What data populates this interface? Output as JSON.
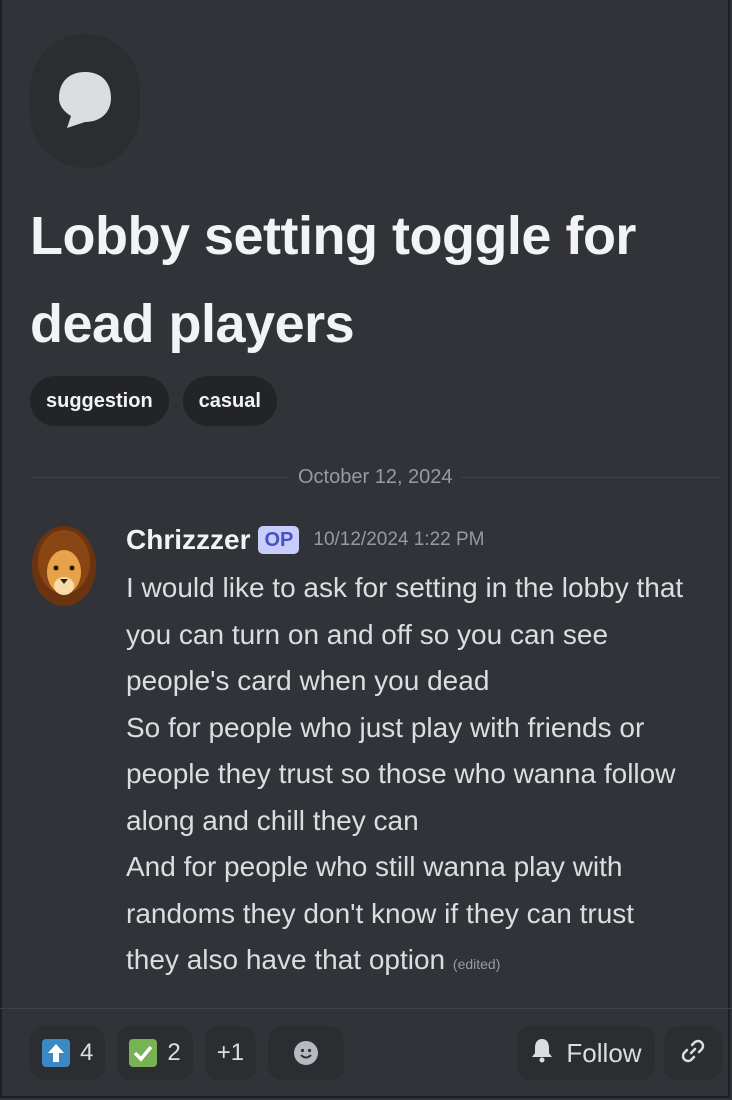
{
  "thread": {
    "icon": "chat-bubble-icon",
    "title": "Lobby setting toggle for dead players",
    "tags": [
      "suggestion",
      "casual"
    ]
  },
  "divider": {
    "date": "October 12, 2024"
  },
  "message": {
    "avatar": "lion-avatar",
    "author": "Chrizzzer",
    "badge": "OP",
    "timestamp": "10/12/2024 1:22 PM",
    "lines": [
      "I would like to ask for setting in the lobby that you can turn on and off so you can see people's card when you dead",
      "So for people who just play with friends or people they trust so those who wanna follow along and chill they can",
      "And for people who still wanna play with randoms they don't know if they can trust they also have that option"
    ],
    "edited": "(edited)"
  },
  "reactions": {
    "items": [
      {
        "icon": "up-arrow-emoji-icon",
        "count": "4"
      },
      {
        "icon": "check-mark-emoji-icon",
        "count": "2"
      }
    ],
    "more": "+1",
    "add_icon": "add-reaction-icon"
  },
  "actions": {
    "follow_label": "Follow",
    "follow_icon": "bell-icon",
    "link_icon": "link-icon"
  },
  "colors": {
    "background": "#313338",
    "op_badge": "#c9cdfb",
    "upvote": "#3b88c3",
    "check": "#77b255"
  }
}
